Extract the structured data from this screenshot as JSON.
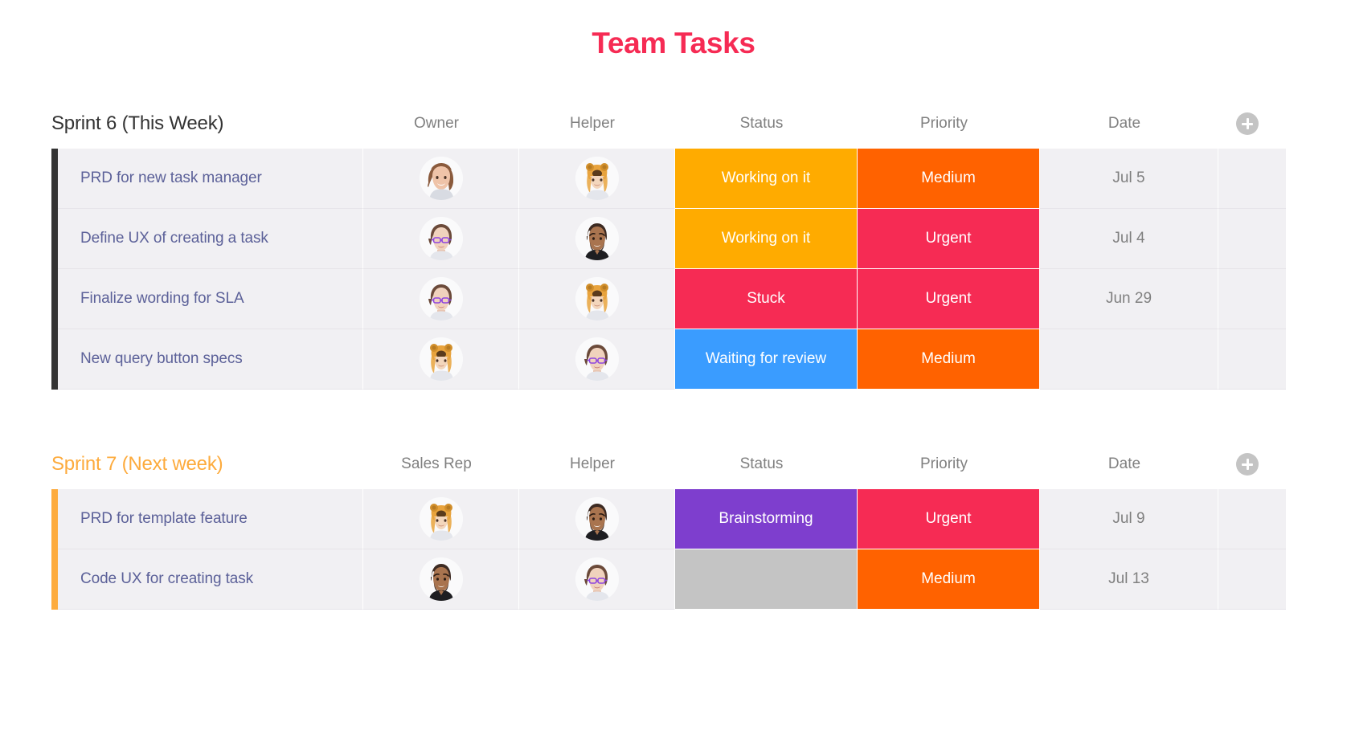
{
  "page": {
    "title": "Team Tasks",
    "title_color": "#F62B54"
  },
  "icons": {
    "add_group_item": "plus-circle-icon"
  },
  "status_colors": {
    "Working on it": "#FFAB00",
    "Stuck": "#F62B54",
    "Waiting for review": "#3A9CFF",
    "Brainstorming": "#7E3ECE",
    "": "#C4C4C4"
  },
  "priority_colors": {
    "Medium": "#FF6200",
    "Urgent": "#F62B54"
  },
  "avatar_colors": {
    "maya": "#8A5A3C",
    "hat": "#E8A33D",
    "glasses": "#6B4A3A",
    "beard": "#3C2A22"
  },
  "groups": [
    {
      "id": "sprint-6",
      "title": "Sprint 6 (This Week)",
      "title_color": "#333333",
      "accent": "#333333",
      "accent_class": "dark",
      "title_class": "dark",
      "columns": {
        "person1": "Owner",
        "person2": "Helper",
        "status": "Status",
        "priority": "Priority",
        "date": "Date"
      },
      "rows": [
        {
          "name": "PRD for new task manager",
          "owner": "avatar-woman-brown-hair",
          "helper": "avatar-person-animal-hat",
          "status": "Working on it",
          "priority": "Medium",
          "date": "Jul 5"
        },
        {
          "name": "Define UX of creating a task",
          "owner": "avatar-person-purple-glasses",
          "helper": "avatar-man-beard-black-shirt",
          "status": "Working on it",
          "priority": "Urgent",
          "date": "Jul 4"
        },
        {
          "name": "Finalize wording for SLA",
          "owner": "avatar-person-purple-glasses",
          "helper": "avatar-person-animal-hat",
          "status": "Stuck",
          "priority": "Urgent",
          "date": "Jun 29"
        },
        {
          "name": "New query button specs",
          "owner": "avatar-person-animal-hat",
          "helper": "avatar-person-purple-glasses",
          "status": "Waiting for review",
          "priority": "Medium",
          "date": ""
        }
      ]
    },
    {
      "id": "sprint-7",
      "title": "Sprint 7 (Next week)",
      "title_color": "#FDAB3D",
      "accent": "#FDAB3D",
      "accent_class": "amber",
      "title_class": "amber",
      "columns": {
        "person1": "Sales Rep",
        "person2": "Helper",
        "status": "Status",
        "priority": "Priority",
        "date": "Date"
      },
      "rows": [
        {
          "name": "PRD for template feature",
          "owner": "avatar-person-animal-hat",
          "helper": "avatar-man-beard-black-shirt",
          "status": "Brainstorming",
          "priority": "Urgent",
          "date": "Jul 9"
        },
        {
          "name": "Code UX for creating task",
          "owner": "avatar-man-beard-black-shirt",
          "helper": "avatar-person-purple-glasses",
          "status": "",
          "priority": "Medium",
          "date": "Jul 13"
        }
      ]
    }
  ]
}
